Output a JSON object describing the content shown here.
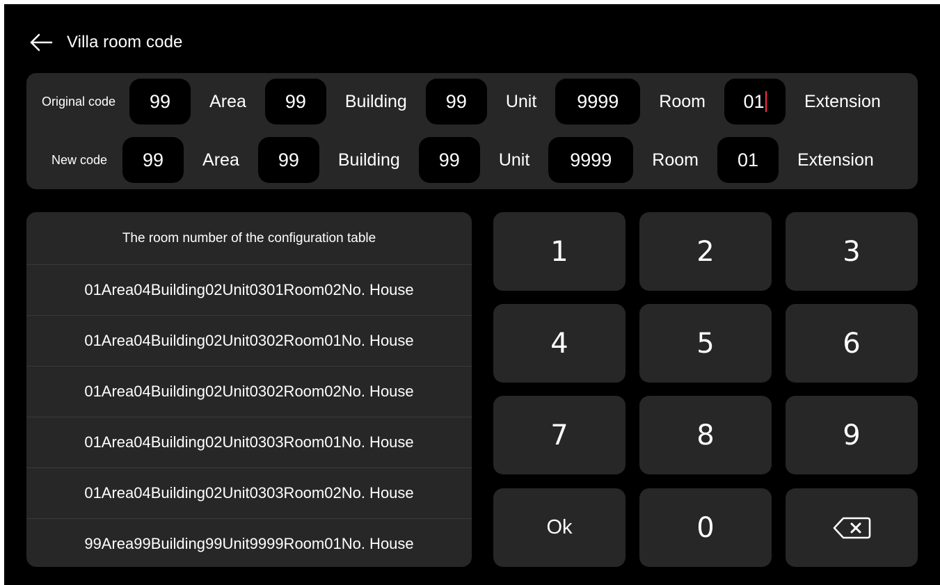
{
  "header": {
    "title": "Villa room code"
  },
  "original_code": {
    "label": "Original code",
    "area": "99",
    "area_label": "Area",
    "building": "99",
    "building_label": "Building",
    "unit": "99",
    "unit_label": "Unit",
    "room": "9999",
    "room_label": "Room",
    "extension": "01",
    "extension_label": "Extension"
  },
  "new_code": {
    "label": "New code",
    "area": "99",
    "area_label": "Area",
    "building": "99",
    "building_label": "Building",
    "unit": "99",
    "unit_label": "Unit",
    "room": "9999",
    "room_label": "Room",
    "extension": "01",
    "extension_label": "Extension"
  },
  "config_table": {
    "header": "The room number of the configuration table",
    "rows": [
      "01Area04Building02Unit0301Room02No. House",
      "01Area04Building02Unit0302Room01No. House",
      "01Area04Building02Unit0302Room02No. House",
      "01Area04Building02Unit0303Room01No. House",
      "01Area04Building02Unit0303Room02No. House",
      "99Area99Building99Unit9999Room01No. House"
    ]
  },
  "keypad": {
    "keys": [
      "1",
      "2",
      "3",
      "4",
      "5",
      "6",
      "7",
      "8",
      "9",
      "Ok",
      "0",
      "backspace-icon"
    ]
  },
  "colors": {
    "background": "#000000",
    "panel": "#272727",
    "text": "#ffffff",
    "cursor": "#ff2b4a"
  }
}
